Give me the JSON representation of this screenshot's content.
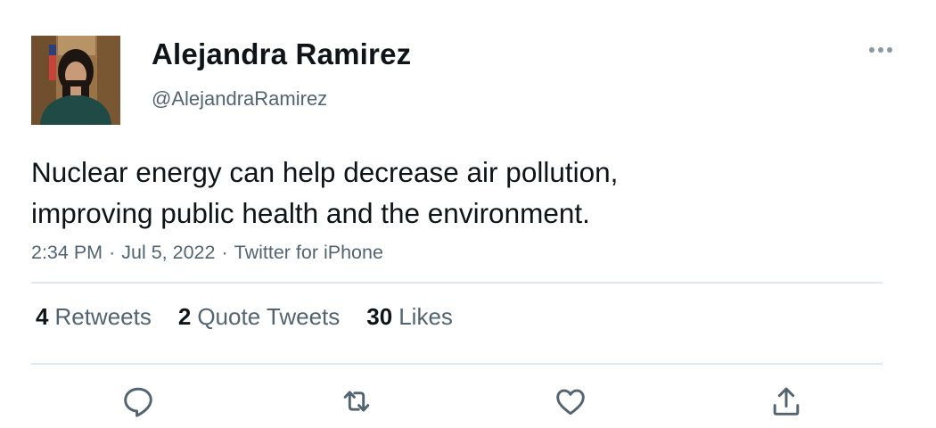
{
  "author": {
    "name": "Alejandra Ramirez",
    "handle": "@AlejandraRamirez"
  },
  "tweet": {
    "text_lines": [
      "Nuclear energy can help decrease air pollution,",
      "improving public health and the environment."
    ],
    "time": "2:34 PM",
    "date": "Jul 5, 2022",
    "source": "Twitter for iPhone",
    "separator": "·"
  },
  "stats": {
    "retweets": {
      "count": "4",
      "label": "Retweets"
    },
    "quotes": {
      "count": "2",
      "label": "Quote Tweets"
    },
    "likes": {
      "count": "30",
      "label": "Likes"
    }
  },
  "actions": [
    {
      "icon": "reply-icon"
    },
    {
      "icon": "retweet-icon"
    },
    {
      "icon": "like-icon"
    },
    {
      "icon": "share-icon"
    }
  ],
  "colors": {
    "text_primary": "#0f1419",
    "text_secondary": "#536471",
    "divider": "#e1e8ed"
  }
}
